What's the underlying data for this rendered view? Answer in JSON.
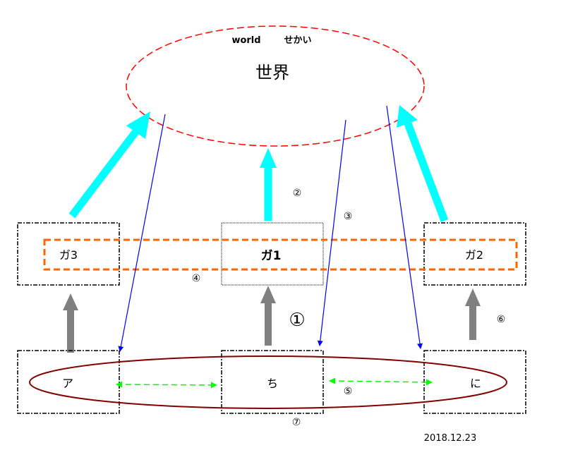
{
  "world": {
    "label_en": "world",
    "label_kana": "せかい",
    "label_kanji": "世界"
  },
  "top_boxes": [
    {
      "id": "ga3",
      "label": "ガ3"
    },
    {
      "id": "ga1",
      "label": "ガ1"
    },
    {
      "id": "ga2",
      "label": "ガ2"
    }
  ],
  "bottom_boxes": [
    {
      "id": "a",
      "label": "ア"
    },
    {
      "id": "chi",
      "label": "ち"
    },
    {
      "id": "ni",
      "label": "に"
    }
  ],
  "markers": {
    "m1": "①",
    "m2": "②",
    "m3": "③",
    "m4": "④",
    "m5": "⑤",
    "m6": "⑥",
    "m7": "⑦"
  },
  "date": "2018.12.23",
  "colors": {
    "world_ellipse": "#ff0000",
    "cyan_arrow": "#00ffff",
    "blue_line": "#0000ff",
    "orange_group": "#ff6600",
    "gray_arrow": "#808080",
    "bottom_ellipse": "#800000",
    "green_arrow": "#00ff00"
  }
}
